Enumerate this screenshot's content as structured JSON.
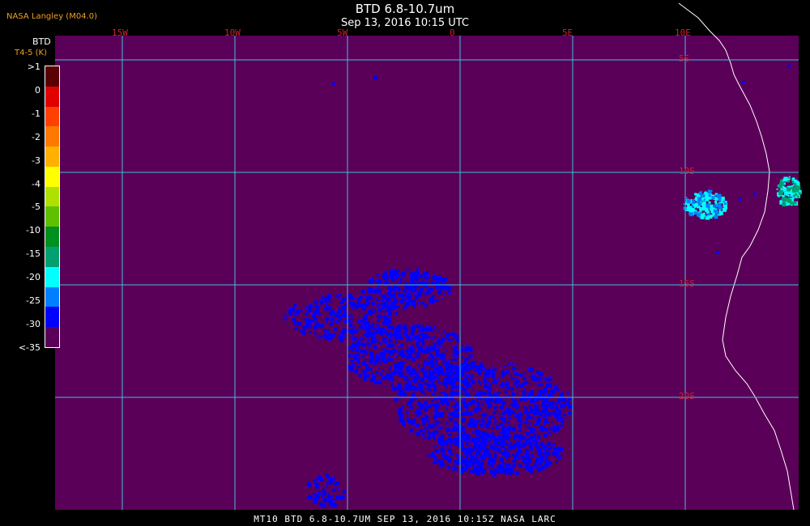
{
  "credit": "NASA Langley (M04.0)",
  "title": "BTD 6.8-10.7um",
  "subtitle": "Sep 13, 2016 10:15 UTC",
  "legend": {
    "line1": "BTD",
    "line2": "T4-5 (K)",
    "ticks": [
      ">1",
      "0",
      "-1",
      "-2",
      "-3",
      "-4",
      "-5",
      "-10",
      "-15",
      "-20",
      "-25",
      "-30",
      "<-35"
    ],
    "colors": [
      "#5a0000",
      "#e00000",
      "#ff4000",
      "#ff7800",
      "#ffb000",
      "#ffff00",
      "#b0e000",
      "#60c000",
      "#009020",
      "#00a070",
      "#00ffff",
      "#0080ff",
      "#0000ff",
      "#5a0058"
    ]
  },
  "map": {
    "background": "#5a0058",
    "grid_color": "#40c0e0",
    "coast_color": "#ffffff",
    "lon_labels": [
      {
        "text": "15W",
        "lon": -15
      },
      {
        "text": "10W",
        "lon": -10
      },
      {
        "text": "5W",
        "lon": -5
      },
      {
        "text": "0",
        "lon": 0
      },
      {
        "text": "5E",
        "lon": 5
      },
      {
        "text": "10E",
        "lon": 10
      }
    ],
    "lat_labels": [
      {
        "text": "5S",
        "lat": -5
      },
      {
        "text": "10S",
        "lat": -10
      },
      {
        "text": "15S",
        "lat": -15
      },
      {
        "text": "20S",
        "lat": -20
      }
    ]
  },
  "footer": "MT10  BTD 6.8-10.7UM  SEP 13, 2016 10:15Z  NASA LARC"
}
